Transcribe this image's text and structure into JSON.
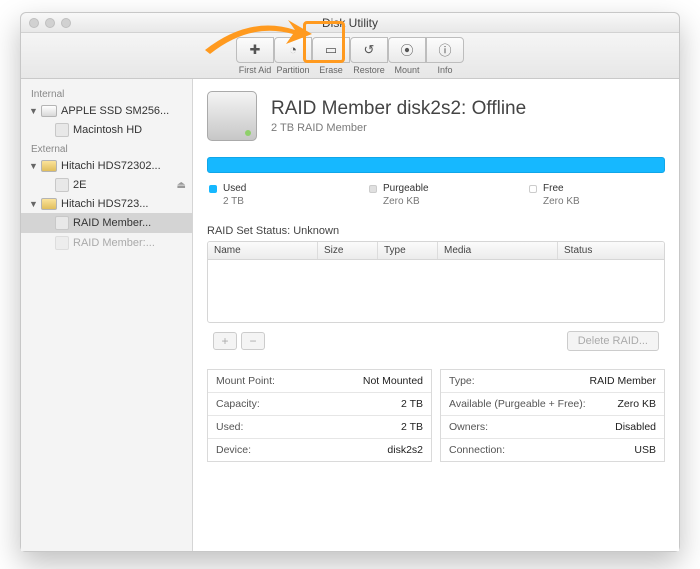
{
  "window": {
    "title": "Disk Utility"
  },
  "toolbar": {
    "first_aid": "First Aid",
    "partition": "Partition",
    "erase": "Erase",
    "restore": "Restore",
    "mount": "Mount",
    "info": "Info"
  },
  "sidebar": {
    "internal_label": "Internal",
    "external_label": "External",
    "items": {
      "internal_disk": "APPLE SSD SM256...",
      "internal_vol": "Macintosh HD",
      "ext1": "Hitachi HDS72302...",
      "ext1_vol": "2E",
      "ext2": "Hitachi HDS723...",
      "ext2_vol1": "RAID Member...",
      "ext2_vol2": "RAID Member:..."
    }
  },
  "volume": {
    "title": "RAID Member disk2s2: Offline",
    "subtitle": "2 TB RAID Member"
  },
  "legend": {
    "used_label": "Used",
    "used_value": "2 TB",
    "purgeable_label": "Purgeable",
    "purgeable_value": "Zero KB",
    "free_label": "Free",
    "free_value": "Zero KB",
    "colors": {
      "used": "#16b8ff",
      "purgeable": "#dcdcdc",
      "free": "#ffffff"
    }
  },
  "raid": {
    "status_title": "RAID Set Status: Unknown",
    "cols": {
      "name": "Name",
      "size": "Size",
      "type": "Type",
      "media": "Media",
      "status": "Status"
    },
    "delete_label": "Delete RAID..."
  },
  "info_left": [
    {
      "k": "Mount Point:",
      "v": "Not Mounted"
    },
    {
      "k": "Capacity:",
      "v": "2 TB"
    },
    {
      "k": "Used:",
      "v": "2 TB"
    },
    {
      "k": "Device:",
      "v": "disk2s2"
    }
  ],
  "info_right": [
    {
      "k": "Type:",
      "v": "RAID Member"
    },
    {
      "k": "Available (Purgeable + Free):",
      "v": "Zero KB"
    },
    {
      "k": "Owners:",
      "v": "Disabled"
    },
    {
      "k": "Connection:",
      "v": "USB"
    }
  ]
}
